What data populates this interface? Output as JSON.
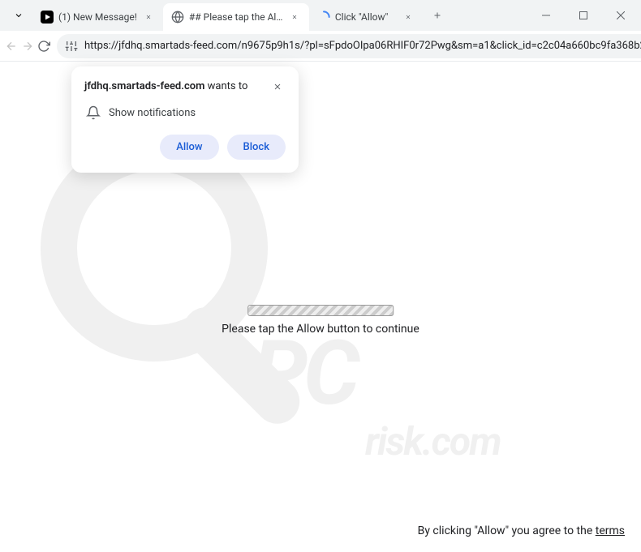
{
  "tabs": [
    {
      "title": "(1) New Message!",
      "favicon": "youtube"
    },
    {
      "title": "## Please tap the Allow button",
      "favicon": "globe"
    },
    {
      "title": "Click \"Allow\"",
      "favicon": "spinner"
    }
  ],
  "url": "https://jfdhq.smartads-feed.com/n9675p9h1s/?pl=sFpdoOIpa06RHIF0r72Pwg&sm=a1&click_id=c2c04a660bc9fa368b25...",
  "prompt": {
    "domain": "jfdhq.smartads-feed.com",
    "wants": "wants to",
    "permission": "Show notifications",
    "allow": "Allow",
    "block": "Block"
  },
  "page": {
    "message": "Please tap the Allow button to continue",
    "footer_prefix": "By clicking \"Allow\" you agree to the ",
    "footer_link": "terms"
  },
  "watermark": {
    "main": "PC",
    "sub": "risk.com"
  }
}
